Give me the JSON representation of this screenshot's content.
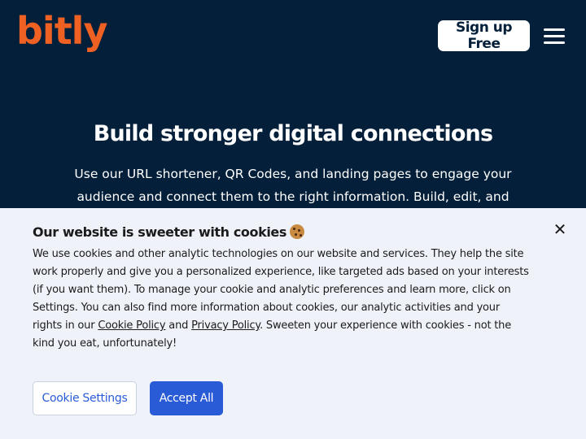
{
  "header": {
    "logo": "bitly",
    "signup_label": "Sign up Free",
    "menu_icon": "hamburger-menu-icon"
  },
  "hero": {
    "title": "Build stronger digital connections",
    "text": "Use our URL shortener, QR Codes, and landing pages to engage your audience and connect them to the right information. Build, edit, and"
  },
  "cookie": {
    "title": "Our website is sweeter with cookies",
    "title_icon": "cookie-icon",
    "text_part1": "We use cookies and other analytic technologies on our website and services. They help the site work properly and give you a personalized experience, like targeted ads based on your interests (if you want them). To manage your cookie and analytic preferences and learn more, click on Settings. You can also find more information about cookies, our analytic activities and your rights in our ",
    "cookie_policy_link": "Cookie Policy",
    "text_and": " and ",
    "privacy_policy_link": "Privacy Policy",
    "text_part2": ". Sweeten your experience with cookies - not the kind you eat, unfortunately!",
    "close_icon": "close-icon",
    "settings_label": "Cookie Settings",
    "accept_label": "Accept All"
  },
  "colors": {
    "background": "#031f39",
    "brand_orange": "#ee6123",
    "banner_bg": "#eff2f9",
    "primary_blue": "#2a5bd7"
  }
}
